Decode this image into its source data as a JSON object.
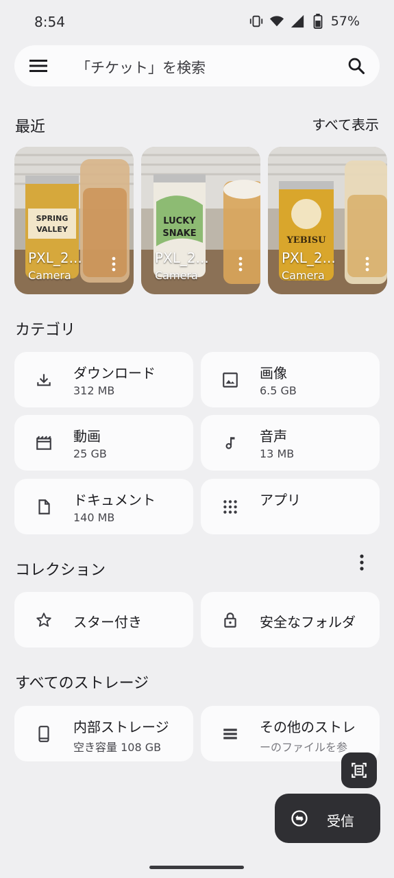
{
  "status_bar": {
    "time": "8:54",
    "battery": "57%"
  },
  "search": {
    "placeholder": "「チケット」を検索"
  },
  "recent": {
    "title": "最近",
    "see_all": "すべて表示",
    "items": [
      {
        "name": "PXL_2...",
        "source": "Camera"
      },
      {
        "name": "PXL_2...",
        "source": "Camera"
      },
      {
        "name": "PXL_2...",
        "source": "Camera"
      }
    ]
  },
  "categories": {
    "title": "カテゴリ",
    "items": [
      {
        "label": "ダウンロード",
        "size": "312 MB",
        "icon": "download-icon"
      },
      {
        "label": "画像",
        "size": "6.5 GB",
        "icon": "image-icon"
      },
      {
        "label": "動画",
        "size": "25 GB",
        "icon": "video-icon"
      },
      {
        "label": "音声",
        "size": "13 MB",
        "icon": "music-note-icon"
      },
      {
        "label": "ドキュメント",
        "size": "140 MB",
        "icon": "document-icon"
      },
      {
        "label": "アプリ",
        "icon": "apps-grid-icon"
      }
    ]
  },
  "collections": {
    "title": "コレクション",
    "items": [
      {
        "label": "スター付き",
        "icon": "star-icon"
      },
      {
        "label": "安全なフォルダ",
        "icon": "lock-icon"
      }
    ]
  },
  "storage": {
    "title": "すべてのストレージ",
    "items": [
      {
        "label": "内部ストレージ",
        "detail": "空き容量 108 GB",
        "icon": "phone-icon"
      },
      {
        "label": "その他のストレ",
        "detail": "ーのファイルを参",
        "icon": "storage-list-icon"
      }
    ]
  },
  "fab": {
    "label": "受信"
  }
}
